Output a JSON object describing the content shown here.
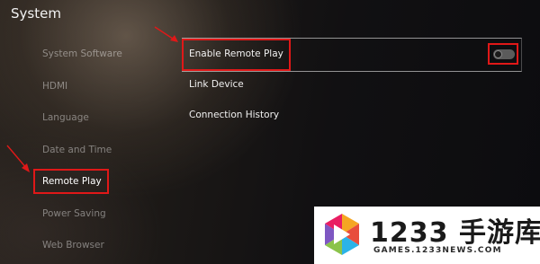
{
  "header": {
    "title": "System"
  },
  "sidebar": {
    "items": [
      {
        "label": "System Software"
      },
      {
        "label": "HDMI"
      },
      {
        "label": "Language"
      },
      {
        "label": "Date and Time"
      },
      {
        "label": "Remote Play"
      },
      {
        "label": "Power Saving"
      },
      {
        "label": "Web Browser"
      }
    ],
    "selected": "Remote Play"
  },
  "main": {
    "items": [
      {
        "label": "Enable Remote Play",
        "toggle": "off"
      },
      {
        "label": "Link Device"
      },
      {
        "label": "Connection History"
      }
    ]
  },
  "annotations": {
    "highlight_color": "#e01818"
  },
  "watermark": {
    "brand": "1233 手游库",
    "url": "GAMES.1233NEWS.COM"
  }
}
